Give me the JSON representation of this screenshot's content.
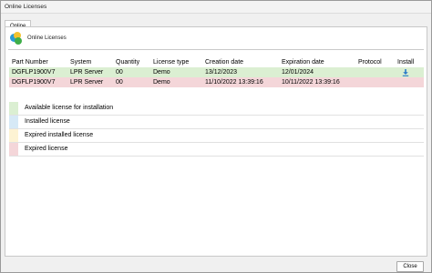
{
  "window": {
    "title": "Online Licenses"
  },
  "tabs": [
    {
      "label": "Online"
    }
  ],
  "header": {
    "title": "Online Licenses",
    "logo_icon": "license-logo-icon"
  },
  "table": {
    "columns": [
      "Part Number",
      "System",
      "Quantity",
      "License type",
      "Creation date",
      "Expiration date",
      "Protocol",
      "Install"
    ],
    "rows": [
      {
        "part_number": "DGFLP1900V7",
        "system": "LPR Server",
        "quantity": "00",
        "license_type": "Demo",
        "creation_date": "13/12/2023",
        "expiration_date": "12/01/2024",
        "protocol": "",
        "install_icon": "download-icon",
        "status": "available"
      },
      {
        "part_number": "DGFLP1900V7",
        "system": "LPR Server",
        "quantity": "00",
        "license_type": "Demo",
        "creation_date": "11/10/2022 13:39:16",
        "expiration_date": "10/11/2022 13:39:16",
        "protocol": "",
        "install_icon": "",
        "status": "expired"
      }
    ]
  },
  "legend": [
    {
      "label": "Available license for installation",
      "color": "#dbefd2"
    },
    {
      "label": "Installed license",
      "color": "#d6e9f6"
    },
    {
      "label": "Expired installed license",
      "color": "#fdf3d3"
    },
    {
      "label": "Expired license",
      "color": "#f4d6d9"
    }
  ],
  "footer": {
    "close_label": "Close"
  },
  "colors": {
    "available": "#dbefd2",
    "expired": "#f4d6d9",
    "accent": "#2a78c8"
  }
}
